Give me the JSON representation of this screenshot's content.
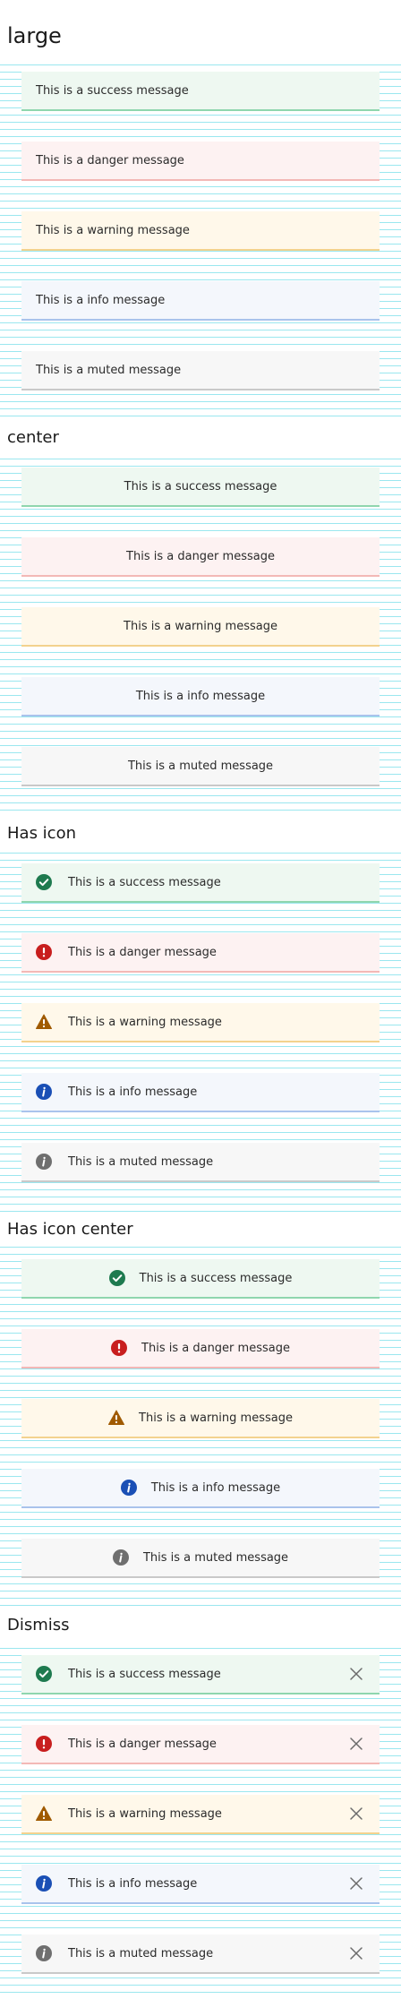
{
  "sections": {
    "large": {
      "heading": "large",
      "alerts": [
        {
          "type": "success",
          "text": "This is a success message"
        },
        {
          "type": "danger",
          "text": "This is a danger message"
        },
        {
          "type": "warning",
          "text": "This is a warning message"
        },
        {
          "type": "info",
          "text": "This is a info message"
        },
        {
          "type": "muted",
          "text": "This is a muted message"
        }
      ]
    },
    "center": {
      "heading": "center",
      "alerts": [
        {
          "type": "success",
          "text": "This is a success message"
        },
        {
          "type": "danger",
          "text": "This is a danger message"
        },
        {
          "type": "warning",
          "text": "This is a warning message"
        },
        {
          "type": "info",
          "text": "This is a info message"
        },
        {
          "type": "muted",
          "text": "This is a muted message"
        }
      ]
    },
    "has_icon": {
      "heading": "Has icon",
      "alerts": [
        {
          "type": "success",
          "text": "This is a success message",
          "icon": "check-circle-icon"
        },
        {
          "type": "danger",
          "text": "This is a danger message",
          "icon": "exclamation-circle-icon"
        },
        {
          "type": "warning",
          "text": "This is a warning message",
          "icon": "warning-triangle-icon"
        },
        {
          "type": "info",
          "text": "This is a info message",
          "icon": "info-circle-icon"
        },
        {
          "type": "muted",
          "text": "This is a muted message",
          "icon": "info-circle-icon"
        }
      ]
    },
    "has_icon_center": {
      "heading": "Has icon center",
      "alerts": [
        {
          "type": "success",
          "text": "This is a success message",
          "icon": "check-circle-icon"
        },
        {
          "type": "danger",
          "text": "This is a danger message",
          "icon": "exclamation-circle-icon"
        },
        {
          "type": "warning",
          "text": "This is a warning message",
          "icon": "warning-triangle-icon"
        },
        {
          "type": "info",
          "text": "This is a info message",
          "icon": "info-circle-icon"
        },
        {
          "type": "muted",
          "text": "This is a muted message",
          "icon": "info-circle-icon"
        }
      ]
    },
    "dismiss": {
      "heading": "Dismiss",
      "alerts": [
        {
          "type": "success",
          "text": "This is a success message",
          "icon": "check-circle-icon",
          "dismiss_icon": "close-icon"
        },
        {
          "type": "danger",
          "text": "This is a danger message",
          "icon": "exclamation-circle-icon",
          "dismiss_icon": "close-icon"
        },
        {
          "type": "warning",
          "text": "This is a warning message",
          "icon": "warning-triangle-icon",
          "dismiss_icon": "close-icon"
        },
        {
          "type": "info",
          "text": "This is a info message",
          "icon": "info-circle-icon",
          "dismiss_icon": "close-icon"
        },
        {
          "type": "muted",
          "text": "This is a muted message",
          "icon": "info-circle-icon",
          "dismiss_icon": "close-icon"
        }
      ]
    }
  },
  "colors": {
    "success_icon": "#1e7a4f",
    "danger_icon": "#c81e1e",
    "warning_icon": "#a05a00",
    "info_icon": "#1a4fb5",
    "muted_icon": "#6f6f6f",
    "dismiss_icon": "#6b6b6b"
  }
}
